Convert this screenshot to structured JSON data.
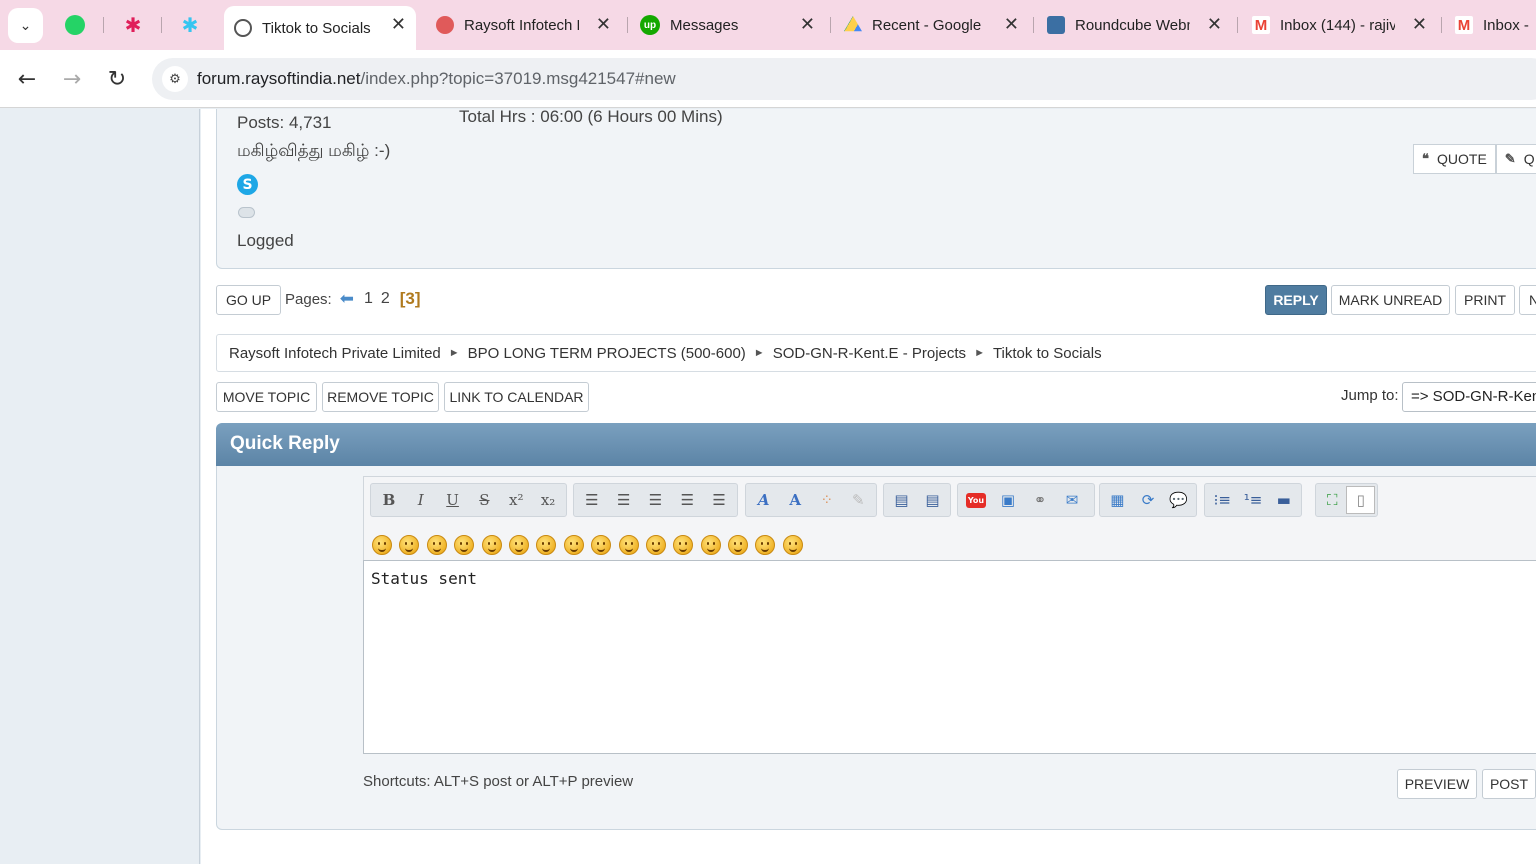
{
  "browser": {
    "tabs": [
      {
        "title": "Tiktok to Socials",
        "active": true
      },
      {
        "title": "Raysoft Infotech P",
        "active": false
      },
      {
        "title": "Messages",
        "active": false
      },
      {
        "title": "Recent - Google Dr",
        "active": false
      },
      {
        "title": "Roundcube Webm",
        "active": false
      },
      {
        "title": "Inbox (144) - rajiv",
        "active": false
      },
      {
        "title": "Inbox - ",
        "active": false
      }
    ],
    "url_host": "forum.raysoftindia.net",
    "url_path": "/index.php?topic=37019.msg421547#new"
  },
  "post": {
    "posts_count": "Posts: 4,731",
    "signature_tamil": "மகிழ்வித்து மகிழ் :-)",
    "logged": "Logged",
    "total_hrs": "Total Hrs : 06:00 (6 Hours 00 Mins)",
    "quote_label": "QUOTE",
    "quick_quote_label": "Q"
  },
  "pagination": {
    "go_up": "GO UP",
    "label": "Pages:",
    "pages": [
      "1",
      "2"
    ],
    "current": "[3]"
  },
  "topic_buttons": {
    "reply": "REPLY",
    "mark_unread": "MARK UNREAD",
    "print": "PRINT",
    "next": "N"
  },
  "linktree": [
    "Raysoft Infotech Private Limited",
    "BPO LONG TERM PROJECTS (500-600)",
    "SOD-GN-R-Kent.E - Projects",
    "Tiktok to Socials"
  ],
  "mod_buttons": {
    "move": "MOVE TOPIC",
    "remove": "REMOVE TOPIC",
    "calendar": "LINK TO CALENDAR"
  },
  "jump": {
    "label": "Jump to:",
    "selected": "=> SOD-GN-R-Kent.E - Projects"
  },
  "quick_reply": {
    "title": "Quick Reply",
    "message": "Status sent",
    "shortcuts": "Shortcuts: ALT+S post or ALT+P preview",
    "preview": "PREVIEW",
    "post": "POST"
  },
  "colors": {
    "tabstrip": "#f6d9e6",
    "header_blue": "#5c84a6",
    "reply_button": "#4f7ca0",
    "current_page": "#b07a1e"
  }
}
